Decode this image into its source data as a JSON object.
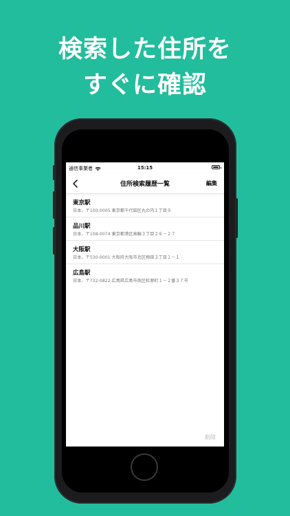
{
  "headline": {
    "line1": "検索した住所を",
    "line2": "すぐに確認"
  },
  "status_bar": {
    "carrier": "通信事業者",
    "time": "15:15"
  },
  "nav": {
    "title": "住所検索履歴一覧",
    "edit_label": "編集"
  },
  "history": [
    {
      "name": "東京駅",
      "address": "日本、〒100-0005 東京都千代田区丸の内１丁目９"
    },
    {
      "name": "品川駅",
      "address": "日本、〒108-0074 東京都港区高輪３丁目２６－２７"
    },
    {
      "name": "大阪駅",
      "address": "日本、〒530-0001 大阪府大阪市北区梅田３丁目１－１"
    },
    {
      "name": "広島駅",
      "address": "日本、〒732-0822 広島県広島市南区松原町１－２番３７号"
    }
  ],
  "toolbar": {
    "delete_label": "削除"
  },
  "colors": {
    "background": "#22bd9c",
    "phone_body": "#1c1c1e"
  }
}
